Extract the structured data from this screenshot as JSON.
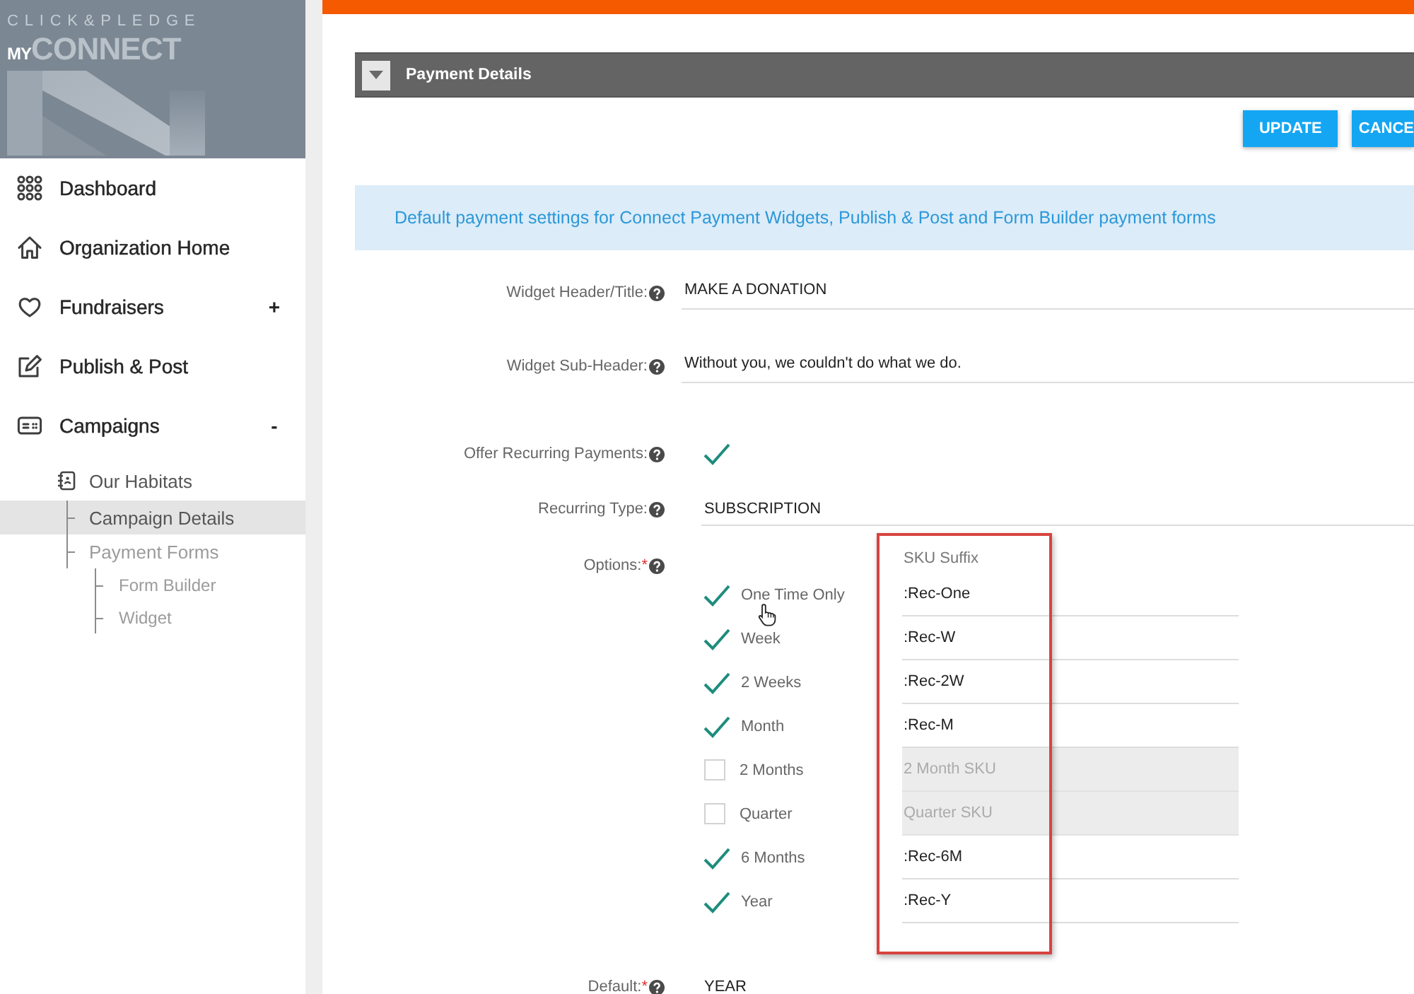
{
  "sidebar": {
    "logo": {
      "brand": "CLICK&PLEDGE",
      "prefix": "MY",
      "product": "CONNECT"
    },
    "menu": [
      {
        "label": "Dashboard",
        "selected": false
      },
      {
        "label": "Organization Home",
        "selected": false
      },
      {
        "label": "Fundraisers",
        "selected": false,
        "toggle": "+"
      },
      {
        "label": "Publish & Post",
        "selected": false
      },
      {
        "label": "Campaigns",
        "selected": false,
        "toggle": "-",
        "children": [
          {
            "label": "Our Habitats",
            "selected": false,
            "children": [
              {
                "label": "Campaign Details",
                "selected": true
              },
              {
                "label": "Payment Forms",
                "selected": false,
                "children": [
                  {
                    "label": "Form Builder",
                    "selected": false
                  },
                  {
                    "label": "Widget",
                    "selected": false
                  }
                ]
              }
            ]
          }
        ]
      }
    ]
  },
  "panel": {
    "title": "Payment Details",
    "expanded": true,
    "buttons": [
      "UPDATE",
      "CANCE"
    ],
    "notice": "Default payment settings for Connect Payment Widgets, Publish & Post and Form Builder payment forms",
    "fields": [
      {
        "kind": "text",
        "label": "Widget Header/Title:",
        "value": "MAKE A DONATION"
      },
      {
        "kind": "text",
        "label": "Widget Sub-Header:",
        "value": "Without you, we couldn't do what we do."
      },
      {
        "kind": "check",
        "label": "Offer Recurring Payments:",
        "checked": true
      },
      {
        "kind": "select",
        "label": "Recurring Type:",
        "value": "SUBSCRIPTION"
      },
      {
        "kind": "options",
        "label": "Options:",
        "required_mark": "*",
        "sku_header": "SKU Suffix",
        "options": [
          {
            "label": "One Time Only",
            "checked": true,
            "sku": ":Rec-One"
          },
          {
            "label": "Week",
            "checked": true,
            "sku": ":Rec-W"
          },
          {
            "label": "2 Weeks",
            "checked": true,
            "sku": ":Rec-2W"
          },
          {
            "label": "Month",
            "checked": true,
            "sku": ":Rec-M"
          },
          {
            "label": "2 Months",
            "checked": false,
            "sku_placeholder": "2 Month SKU"
          },
          {
            "label": "Quarter",
            "checked": false,
            "sku_placeholder": "Quarter SKU"
          },
          {
            "label": "6 Months",
            "checked": true,
            "sku": ":Rec-6M"
          },
          {
            "label": "Year",
            "checked": true,
            "sku": ":Rec-Y"
          }
        ]
      },
      {
        "kind": "select",
        "label": "Default:",
        "required_mark": "*",
        "value": "YEAR"
      }
    ]
  }
}
